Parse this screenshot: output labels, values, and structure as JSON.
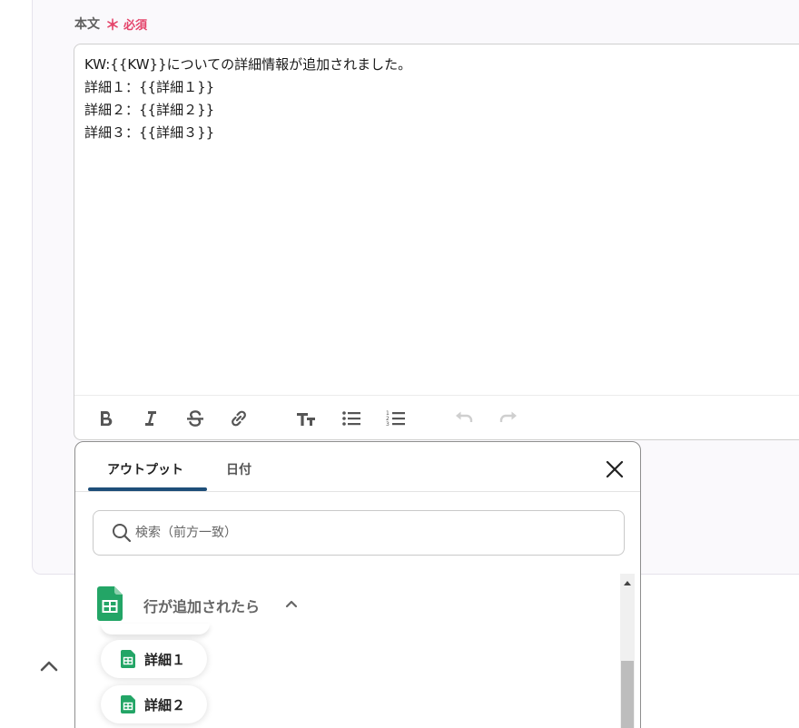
{
  "field": {
    "label": "本文",
    "required_mark": "＊",
    "required_text": "必須"
  },
  "editor": {
    "lines": [
      "KW:{{KW}}についての詳細情報が追加されました。",
      "詳細１：{{詳細１}}",
      "詳細２：{{詳細２}}",
      "詳細３：{{詳細３}}"
    ],
    "toolbar": [
      "bold-icon",
      "italic-icon",
      "strikethrough-icon",
      "link-icon",
      "text-size-icon",
      "bullet-list-icon",
      "numbered-list-icon",
      "undo-icon",
      "redo-icon"
    ]
  },
  "popup": {
    "tabs": [
      {
        "label": "アウトプット",
        "active": true
      },
      {
        "label": "日付",
        "active": false
      }
    ],
    "search": {
      "placeholder": "検索（前方一致）",
      "value": ""
    },
    "section": {
      "title": "行が追加されたら"
    },
    "items": [
      {
        "label": "詳細１"
      },
      {
        "label": "詳細２"
      }
    ]
  },
  "colors": {
    "accent": "#1e4e79",
    "required": "#e4446a",
    "sheets_green": "#23a566"
  }
}
